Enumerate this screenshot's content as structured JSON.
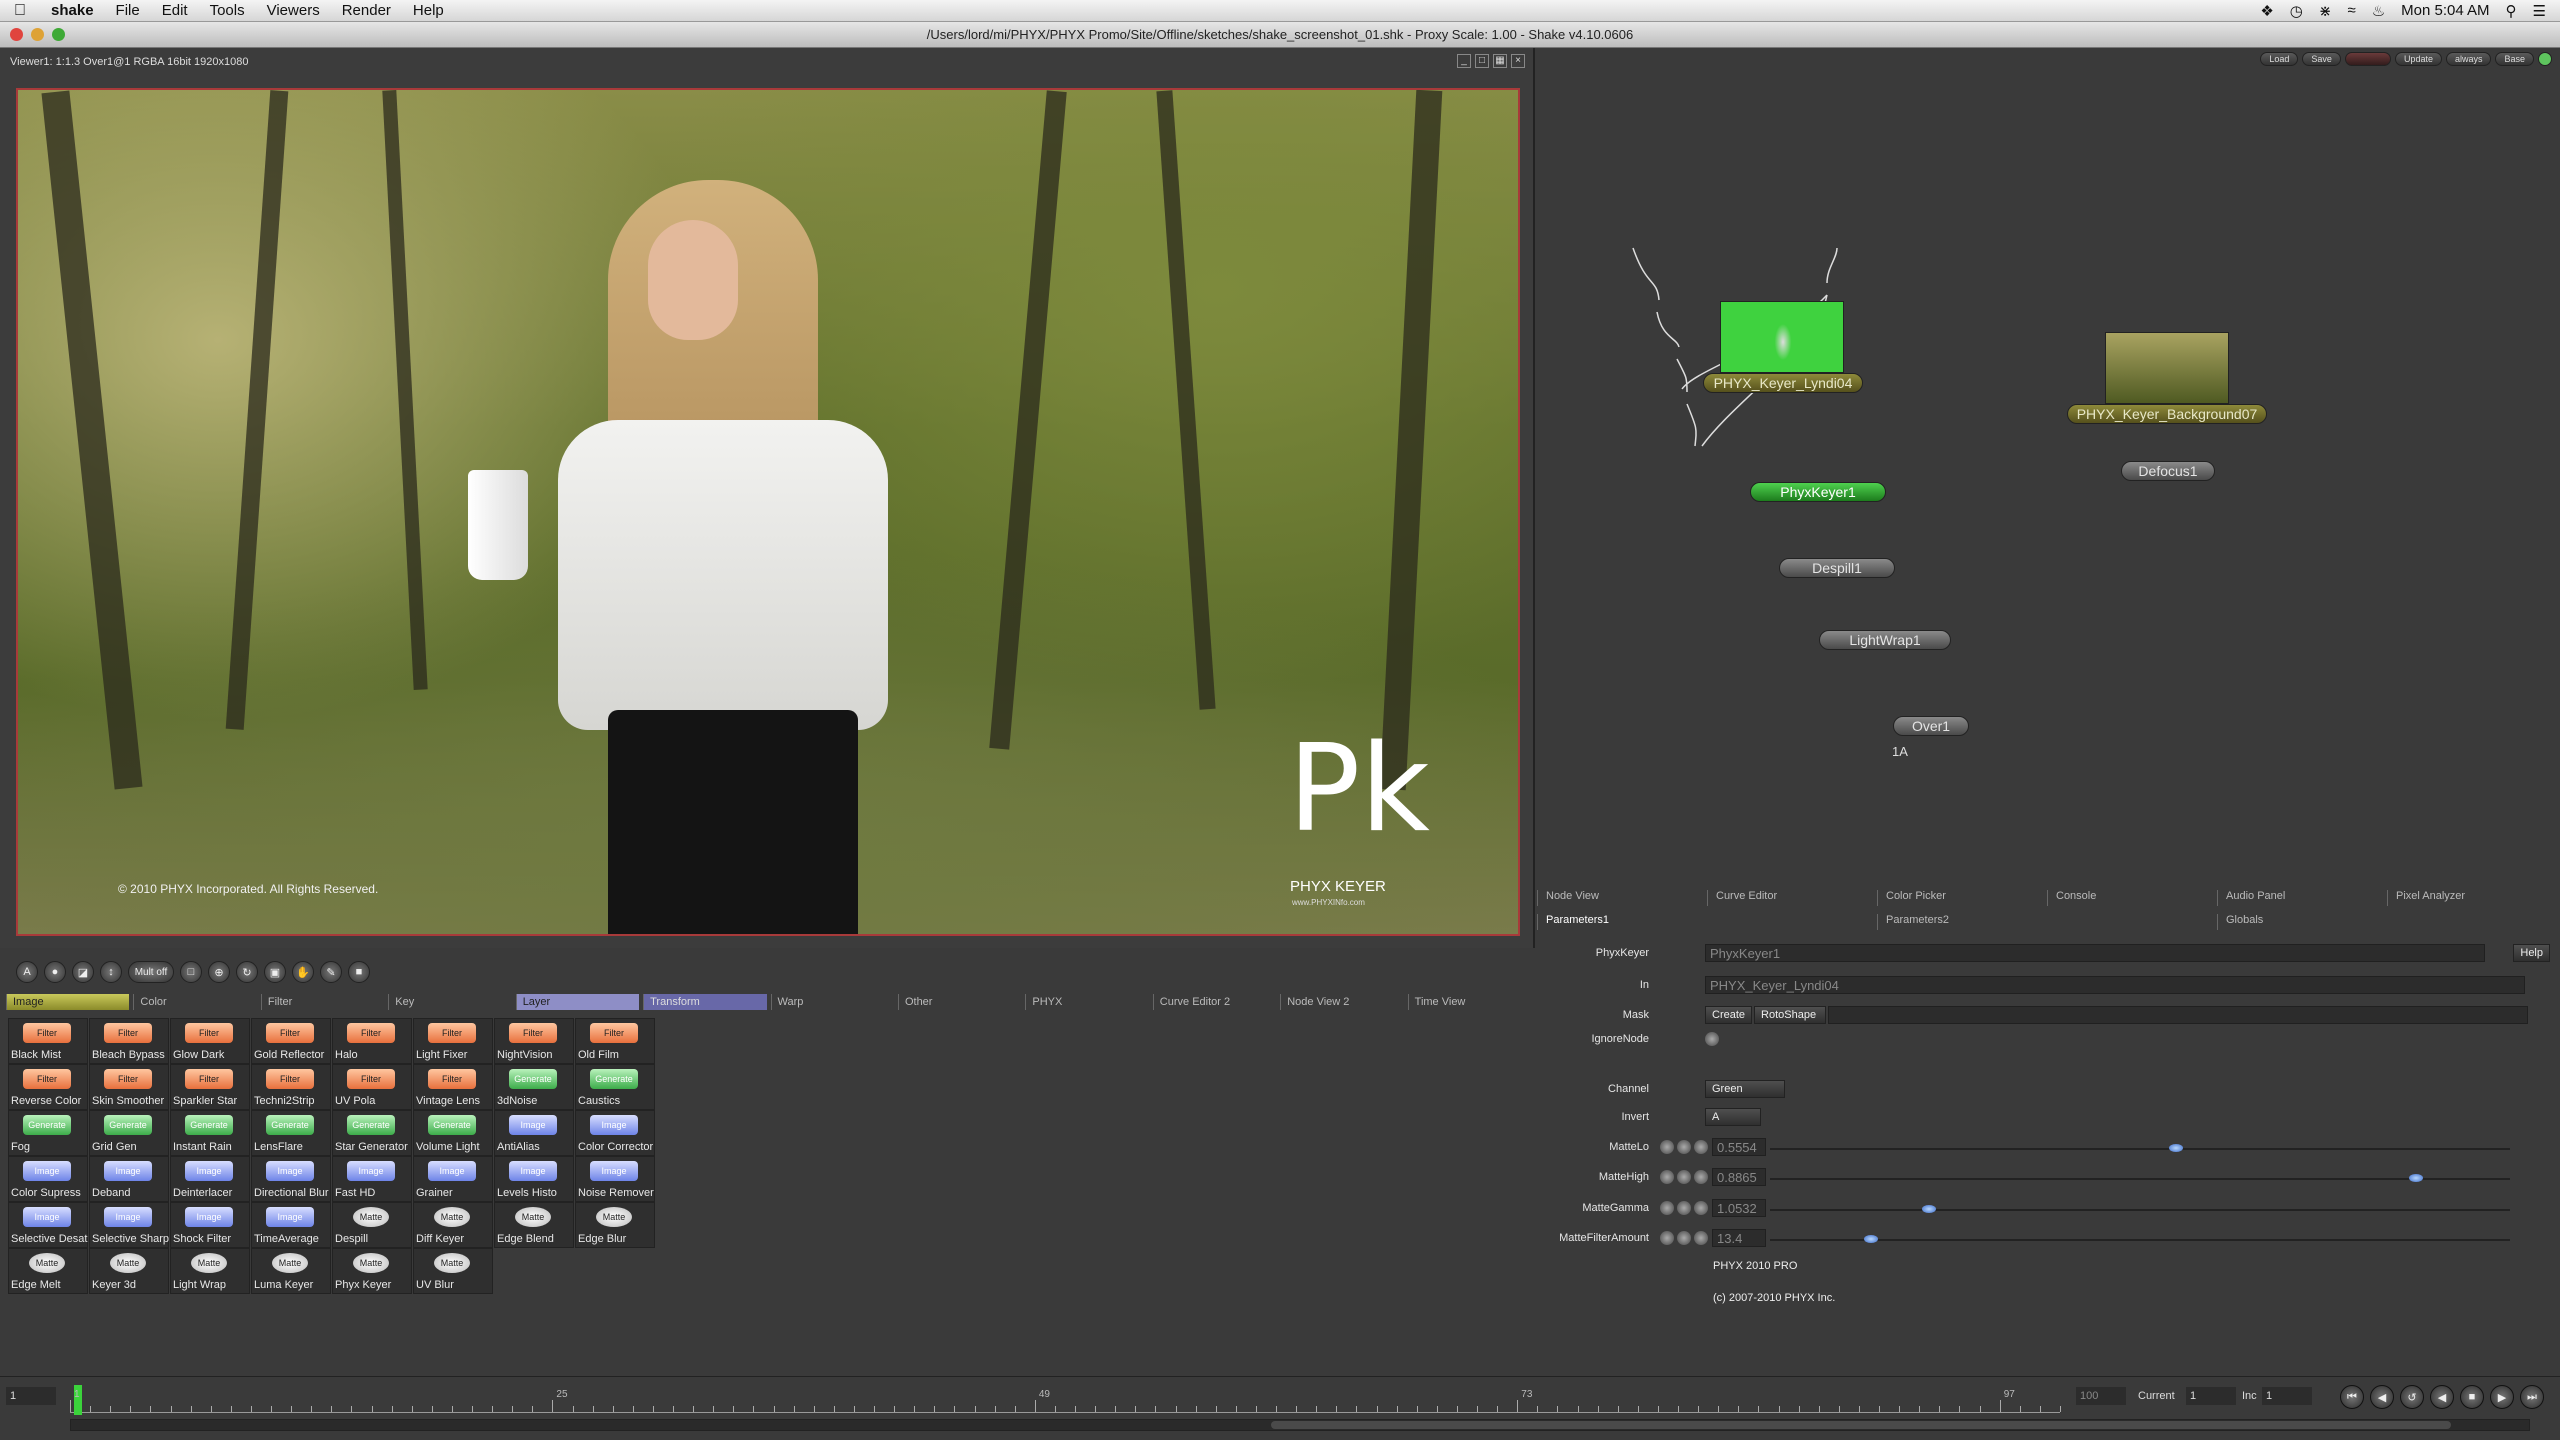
{
  "menubar": {
    "app": "shake",
    "items": [
      "File",
      "Edit",
      "Tools",
      "Viewers",
      "Render",
      "Help"
    ],
    "clock": "Mon 5:04 AM"
  },
  "window": {
    "title": "/Users/lord/mi/PHYX/PHYX Promo/Site/Offline/sketches/shake_screenshot_01.shk - Proxy Scale: 1.00 - Shake v4.10.0606"
  },
  "viewer": {
    "info": "Viewer1: 1:1.3 Over1@1 RGBA 16bit 1920x1080",
    "copyright": "© 2010 PHYX Incorporated.  All Rights Reserved.",
    "logo_mark": "Pk",
    "logo_text": "PHYX KEYER",
    "logo_url": "www.PHYXINfo.com",
    "toolbar_wide_label": "Mult off"
  },
  "tool_tabs": [
    {
      "label": "Image"
    },
    {
      "label": "Color"
    },
    {
      "label": "Filter"
    },
    {
      "label": "Key"
    },
    {
      "label": "Layer"
    },
    {
      "label": "Transform"
    },
    {
      "label": "Warp"
    },
    {
      "label": "Other"
    },
    {
      "label": "PHYX"
    },
    {
      "label": "Curve Editor 2"
    },
    {
      "label": "Node View 2"
    },
    {
      "label": "Time View"
    }
  ],
  "tools": [
    {
      "chip": "Filter",
      "label": "Black Mist"
    },
    {
      "chip": "Filter",
      "label": "Bleach Bypass"
    },
    {
      "chip": "Filter",
      "label": "Glow Dark"
    },
    {
      "chip": "Filter",
      "label": "Gold Reflector"
    },
    {
      "chip": "Filter",
      "label": "Halo"
    },
    {
      "chip": "Filter",
      "label": "Light Fixer"
    },
    {
      "chip": "Filter",
      "label": "NightVision"
    },
    {
      "chip": "Filter",
      "label": "Old Film"
    },
    {
      "chip": "Filter",
      "label": "Reverse Color"
    },
    {
      "chip": "Filter",
      "label": "Skin Smoother"
    },
    {
      "chip": "Filter",
      "label": "Sparkler Star"
    },
    {
      "chip": "Filter",
      "label": "Techni2Strip"
    },
    {
      "chip": "Filter",
      "label": "UV Pola"
    },
    {
      "chip": "Filter",
      "label": "Vintage Lens"
    },
    {
      "chip": "Generate",
      "label": "3dNoise"
    },
    {
      "chip": "Generate",
      "label": "Caustics"
    },
    {
      "chip": "Generate",
      "label": "Fog"
    },
    {
      "chip": "Generate",
      "label": "Grid Gen"
    },
    {
      "chip": "Generate",
      "label": "Instant Rain"
    },
    {
      "chip": "Generate",
      "label": "LensFlare"
    },
    {
      "chip": "Generate",
      "label": "Star Generator"
    },
    {
      "chip": "Generate",
      "label": "Volume Light"
    },
    {
      "chip": "Image",
      "label": "AntiAlias"
    },
    {
      "chip": "Image",
      "label": "Color Corrector"
    },
    {
      "chip": "Image",
      "label": "Color Supress"
    },
    {
      "chip": "Image",
      "label": "Deband"
    },
    {
      "chip": "Image",
      "label": "Deinterlacer"
    },
    {
      "chip": "Image",
      "label": "Directional Blur"
    },
    {
      "chip": "Image",
      "label": "Fast HD"
    },
    {
      "chip": "Image",
      "label": "Grainer"
    },
    {
      "chip": "Image",
      "label": "Levels Histo"
    },
    {
      "chip": "Image",
      "label": "Noise Remover"
    },
    {
      "chip": "Image",
      "label": "Selective Desat"
    },
    {
      "chip": "Image",
      "label": "Selective Sharp"
    },
    {
      "chip": "Image",
      "label": "Shock Filter"
    },
    {
      "chip": "Image",
      "label": "TimeAverage"
    },
    {
      "chip": "Matte",
      "label": "Despill"
    },
    {
      "chip": "Matte",
      "label": "Diff Keyer"
    },
    {
      "chip": "Matte",
      "label": "Edge Blend"
    },
    {
      "chip": "Matte",
      "label": "Edge Blur"
    },
    {
      "chip": "Matte",
      "label": "Edge Melt"
    },
    {
      "chip": "Matte",
      "label": "Keyer 3d"
    },
    {
      "chip": "Matte",
      "label": "Light Wrap"
    },
    {
      "chip": "Matte",
      "label": "Luma Keyer"
    },
    {
      "chip": "Matte",
      "label": "Phyx Keyer"
    },
    {
      "chip": "Matte",
      "label": "UV Blur"
    }
  ],
  "node_toolbar": [
    "Load",
    "Save",
    "Update",
    "always",
    "Base"
  ],
  "nodes": {
    "file1": "PHYX_Keyer_Lyndi04",
    "file2": "PHYX_Keyer_Background07",
    "keyer": "PhyxKeyer1",
    "defocus": "Defocus1",
    "despill": "Despill1",
    "lightwrap": "LightWrap1",
    "over": "Over1",
    "tag": "1A"
  },
  "view_tabs": [
    "Node View",
    "Curve Editor",
    "Color Picker",
    "Console",
    "Audio Panel",
    "Pixel Analyzer"
  ],
  "param_tabs": [
    "Parameters1",
    "Parameters2",
    "Globals"
  ],
  "params": {
    "help": "Help",
    "phyxkeyer_label": "PhyxKeyer",
    "phyxkeyer_value": "PhyxKeyer1",
    "in_label": "In",
    "in_value": "PHYX_Keyer_Lyndi04",
    "mask_label": "Mask",
    "mask_create": "Create",
    "mask_shape": "RotoShape",
    "ignore_label": "IgnoreNode",
    "channel_label": "Channel",
    "channel_value": "Green",
    "invert_label": "Invert",
    "invert_value": "A",
    "mattelo_label": "MatteLo",
    "mattelo_value": "0.5554",
    "mattehigh_label": "MatteHigh",
    "mattehigh_value": "0.8865",
    "mattegamma_label": "MatteGamma",
    "mattegamma_value": "1.0532",
    "mattefilter_label": "MatteFilterAmount",
    "mattefilter_value": "13.4",
    "pro_text": "PHYX 2010 PRO",
    "pro_copy": "(c) 2007-2010 PHYX Inc.",
    "slider_mattelo": 0.55,
    "slider_mattehigh": 0.88,
    "slider_mattegamma": 0.21,
    "slider_mattefilter": 0.13
  },
  "timeline": {
    "start": "1",
    "end": "100",
    "current_label": "Current",
    "current": "1",
    "inc_label": "Inc",
    "inc": "1",
    "ticks": [
      "1",
      "25",
      "49",
      "73",
      "97"
    ]
  }
}
